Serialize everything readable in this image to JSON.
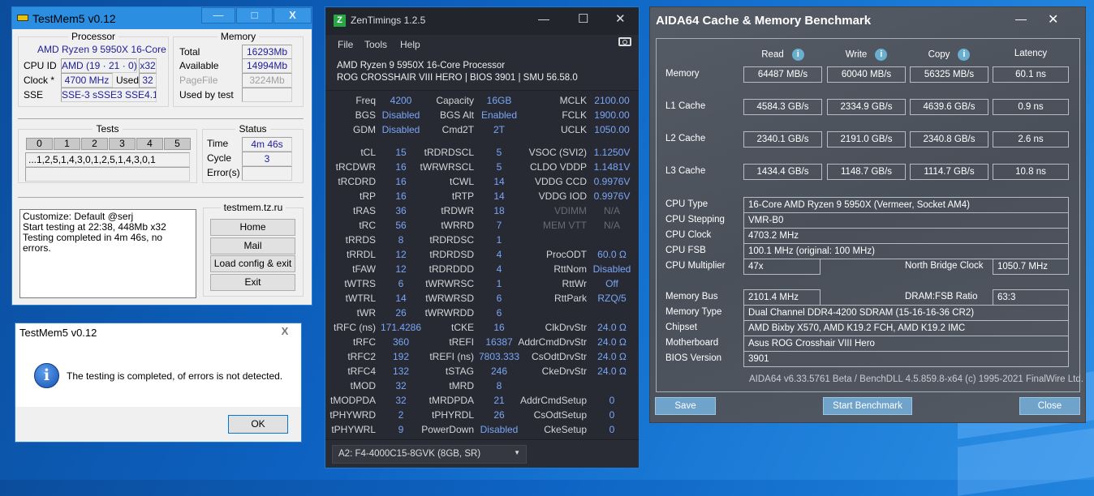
{
  "testmem": {
    "title": "TestMem5 v0.12",
    "processor": {
      "heading": "Processor",
      "name": "AMD Ryzen 9 5950X 16-Core",
      "cpuid_label": "CPU ID",
      "cpuid": "AMD  (19 · 21 · 0)",
      "threads": "x32",
      "clock_label": "Clock *",
      "clock": "4700 MHz",
      "used_label": "Used",
      "used": "32",
      "sse_label": "SSE",
      "sse": "SSE-3 sSSE3 SSE4.1"
    },
    "memory": {
      "heading": "Memory",
      "total_label": "Total",
      "total": "16293Mb",
      "available_label": "Available",
      "available": "14994Mb",
      "pagefile_label": "PageFile",
      "pagefile": "3224Mb",
      "usedby_label": "Used by test",
      "usedby": ""
    },
    "tests": {
      "heading": "Tests",
      "tabs": [
        "0",
        "1",
        "2",
        "3",
        "4",
        "5"
      ],
      "sequence": "...1,2,5,1,4,3,0,1,2,5,1,4,3,0,1"
    },
    "status": {
      "heading": "Status",
      "time_label": "Time",
      "time": "4m 46s",
      "cycle_label": "Cycle",
      "cycle": "3",
      "errors_label": "Error(s)",
      "errors": ""
    },
    "log": [
      "Customize: Default @serj",
      "Start testing at 22:38, 448Mb x32",
      "Testing completed in 4m 46s, no errors."
    ],
    "links": {
      "heading": "testmem.tz.ru",
      "buttons": [
        "Home",
        "Mail",
        "Load config & exit",
        "Exit"
      ]
    }
  },
  "dialog": {
    "title": "TestMem5 v0.12",
    "message": "The testing is completed, of errors is not detected.",
    "ok": "OK"
  },
  "zen": {
    "title": "ZenTimings 1.2.5",
    "menu": [
      "File",
      "Tools",
      "Help"
    ],
    "cpu": "AMD Ryzen 9 5950X 16-Core Processor",
    "board": "ROG CROSSHAIR VIII HERO | BIOS 3901 | SMU 56.58.0",
    "rows": [
      [
        [
          "Freq",
          "4200"
        ],
        [
          "Capacity",
          "16GB"
        ],
        [
          "MCLK",
          "2100.00"
        ]
      ],
      [
        [
          "BGS",
          "Disabled"
        ],
        [
          "BGS Alt",
          "Enabled"
        ],
        [
          "FCLK",
          "1900.00"
        ]
      ],
      [
        [
          "GDM",
          "Disabled"
        ],
        [
          "Cmd2T",
          "2T"
        ],
        [
          "UCLK",
          "1050.00"
        ]
      ],
      [
        [
          "tCL",
          "15"
        ],
        [
          "tRDRDSCL",
          "5"
        ],
        [
          "VSOC (SVI2)",
          "1.1250V"
        ]
      ],
      [
        [
          "tRCDWR",
          "16"
        ],
        [
          "tWRWRSCL",
          "5"
        ],
        [
          "CLDO VDDP",
          "1.1481V"
        ]
      ],
      [
        [
          "tRCDRD",
          "16"
        ],
        [
          "tCWL",
          "14"
        ],
        [
          "VDDG CCD",
          "0.9976V"
        ]
      ],
      [
        [
          "tRP",
          "16"
        ],
        [
          "tRTP",
          "14"
        ],
        [
          "VDDG IOD",
          "0.9976V"
        ]
      ],
      [
        [
          "tRAS",
          "36"
        ],
        [
          "tRDWR",
          "18"
        ],
        [
          "VDIMM",
          "N/A",
          true
        ]
      ],
      [
        [
          "tRC",
          "56"
        ],
        [
          "tWRRD",
          "7"
        ],
        [
          "MEM VTT",
          "N/A",
          true
        ]
      ],
      [
        [
          "tRRDS",
          "8"
        ],
        [
          "tRDRDSC",
          "1"
        ],
        null
      ],
      [
        [
          "tRRDL",
          "12"
        ],
        [
          "tRDRDSD",
          "4"
        ],
        [
          "ProcODT",
          "60.0 Ω"
        ]
      ],
      [
        [
          "tFAW",
          "12"
        ],
        [
          "tRDRDDD",
          "4"
        ],
        [
          "RttNom",
          "Disabled"
        ]
      ],
      [
        [
          "tWTRS",
          "6"
        ],
        [
          "tWRWRSC",
          "1"
        ],
        [
          "RttWr",
          "Off"
        ]
      ],
      [
        [
          "tWTRL",
          "14"
        ],
        [
          "tWRWRSD",
          "6"
        ],
        [
          "RttPark",
          "RZQ/5"
        ]
      ],
      [
        [
          "tWR",
          "26"
        ],
        [
          "tWRWRDD",
          "6"
        ],
        null
      ],
      [
        [
          "tRFC (ns)",
          "171.4286"
        ],
        [
          "tCKE",
          "16"
        ],
        [
          "ClkDrvStr",
          "24.0 Ω"
        ]
      ],
      [
        [
          "tRFC",
          "360"
        ],
        [
          "tREFI",
          "16387"
        ],
        [
          "AddrCmdDrvStr",
          "24.0 Ω"
        ]
      ],
      [
        [
          "tRFC2",
          "192"
        ],
        [
          "tREFI (ns)",
          "7803.333"
        ],
        [
          "CsOdtDrvStr",
          "24.0 Ω"
        ]
      ],
      [
        [
          "tRFC4",
          "132"
        ],
        [
          "tSTAG",
          "246"
        ],
        [
          "CkeDrvStr",
          "24.0 Ω"
        ]
      ],
      [
        [
          "tMOD",
          "32"
        ],
        [
          "tMRD",
          "8"
        ],
        null
      ],
      [
        [
          "tMODPDA",
          "32"
        ],
        [
          "tMRDPDA",
          "21"
        ],
        [
          "AddrCmdSetup",
          "0"
        ]
      ],
      [
        [
          "tPHYWRD",
          "2"
        ],
        [
          "tPHYRDL",
          "26"
        ],
        [
          "CsOdtSetup",
          "0"
        ]
      ],
      [
        [
          "tPHYWRL",
          "9"
        ],
        [
          "PowerDown",
          "Disabled"
        ],
        [
          "CkeSetup",
          "0"
        ]
      ]
    ],
    "module": "A2: F4-4000C15-8GVK (8GB, SR)"
  },
  "aida": {
    "title": "AIDA64 Cache & Memory Benchmark",
    "columns": [
      "Read",
      "Write",
      "Copy",
      "Latency"
    ],
    "bench": [
      {
        "label": "Memory",
        "values": [
          "64487 MB/s",
          "60040 MB/s",
          "56325 MB/s",
          "60.1 ns"
        ]
      },
      {
        "label": "L1 Cache",
        "values": [
          "4584.3 GB/s",
          "2334.9 GB/s",
          "4639.6 GB/s",
          "0.9 ns"
        ]
      },
      {
        "label": "L2 Cache",
        "values": [
          "2340.1 GB/s",
          "2191.0 GB/s",
          "2340.8 GB/s",
          "2.6 ns"
        ]
      },
      {
        "label": "L3 Cache",
        "values": [
          "1434.4 GB/s",
          "1148.7 GB/s",
          "1114.7 GB/s",
          "10.8 ns"
        ]
      }
    ],
    "info1": [
      {
        "label": "CPU Type",
        "value": "16-Core AMD Ryzen 9 5950X  (Vermeer, Socket AM4)"
      },
      {
        "label": "CPU Stepping",
        "value": "VMR-B0"
      },
      {
        "label": "CPU Clock",
        "value": "4703.2 MHz"
      },
      {
        "label": "CPU FSB",
        "value": "100.1 MHz  (original: 100 MHz)"
      }
    ],
    "multiplier": {
      "label": "CPU Multiplier",
      "value": "47x",
      "nb_label": "North Bridge Clock",
      "nb_value": "1050.7 MHz"
    },
    "membus": {
      "label": "Memory Bus",
      "value": "2101.4 MHz",
      "ratio_label": "DRAM:FSB Ratio",
      "ratio_value": "63:3"
    },
    "info2": [
      {
        "label": "Memory Type",
        "value": "Dual Channel DDR4-4200 SDRAM  (15-16-16-36 CR2)"
      },
      {
        "label": "Chipset",
        "value": "AMD Bixby X570, AMD K19.2 FCH, AMD K19.2 IMC"
      },
      {
        "label": "Motherboard",
        "value": "Asus ROG Crosshair VIII Hero"
      },
      {
        "label": "BIOS Version",
        "value": "3901"
      }
    ],
    "footer": "AIDA64 v6.33.5761 Beta / BenchDLL 4.5.859.8-x64  (c) 1995-2021 FinalWire Ltd.",
    "buttons": {
      "save": "Save",
      "start": "Start Benchmark",
      "close": "Close"
    }
  }
}
